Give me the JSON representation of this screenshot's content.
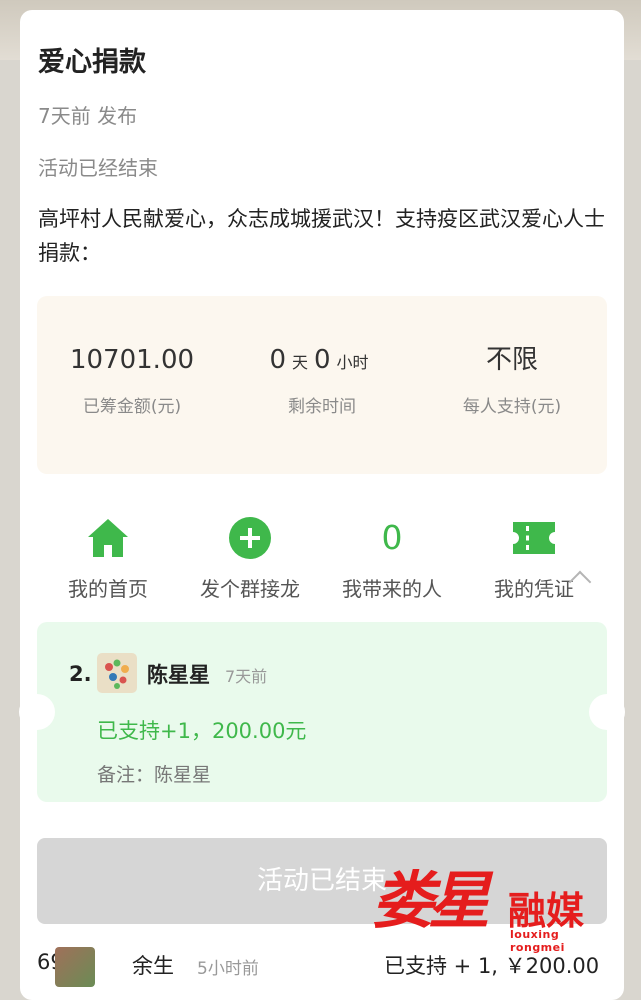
{
  "event": {
    "title": "爱心捐款",
    "published": "7天前 发布",
    "status": "活动已经结束",
    "description": "高坪村人民献爱心，众志成城援武汉！支持疫区武汉爱心人士捐款："
  },
  "stats": {
    "raised_value": "10701.00",
    "raised_label": "已筹金额(元)",
    "remain_days": "0",
    "remain_days_unit": "天",
    "remain_hours": "0",
    "remain_hours_unit": "小时",
    "remain_label": "剩余时间",
    "limit_value": "不限",
    "limit_label": "每人支持(元)"
  },
  "actions": [
    {
      "label": "我的首页",
      "icon": "home-icon"
    },
    {
      "label": "发个群接龙",
      "icon": "plus-circle-icon"
    },
    {
      "label": "我带来的人",
      "value": "0"
    },
    {
      "label": "我的凭证",
      "icon": "ticket-icon"
    }
  ],
  "ticket": {
    "index": "2.",
    "name": "陈星星",
    "time": "7天前",
    "support": "已支持+1，200.00元",
    "note": "备注：陈星星"
  },
  "end_button": "活动已结束",
  "list_row": {
    "index": "69.",
    "name": "余生",
    "time": "5小时前",
    "support": "已支持 + 1, ￥200.00"
  },
  "watermark": {
    "sign": "娄星",
    "brand": "融媒",
    "sub": "louxing rongmei"
  },
  "colors": {
    "accent_green": "#3fb84b",
    "ticket_bg": "#e9faec",
    "stats_bg": "#fcf7ef",
    "watermark_red": "#e51d1d"
  }
}
